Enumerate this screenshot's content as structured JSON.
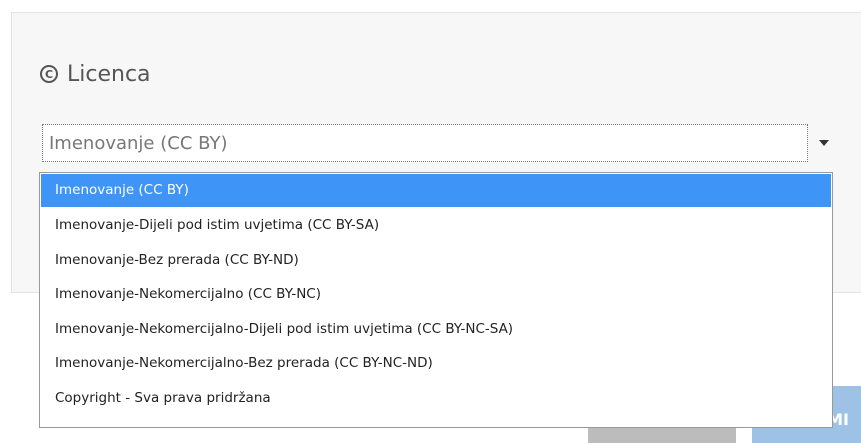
{
  "license": {
    "title": "Licenca",
    "icon": "copyright-icon",
    "selected_value": "Imenovanje (CC BY)",
    "options": [
      "Imenovanje (CC BY)",
      "Imenovanje-Dijeli pod istim uvjetima (CC BY-SA)",
      "Imenovanje-Bez prerada (CC BY-ND)",
      "Imenovanje-Nekomercijalno (CC BY-NC)",
      "Imenovanje-Nekomercijalno-Dijeli pod istim uvjetima (CC BY-NC-SA)",
      "Imenovanje-Nekomercijalno-Bez prerada (CC BY-NC-ND)",
      "Copyright - Sva prava pridržana"
    ],
    "highlight_color": "#3e95f7"
  },
  "footer": {
    "primary_button_label": "MI"
  }
}
